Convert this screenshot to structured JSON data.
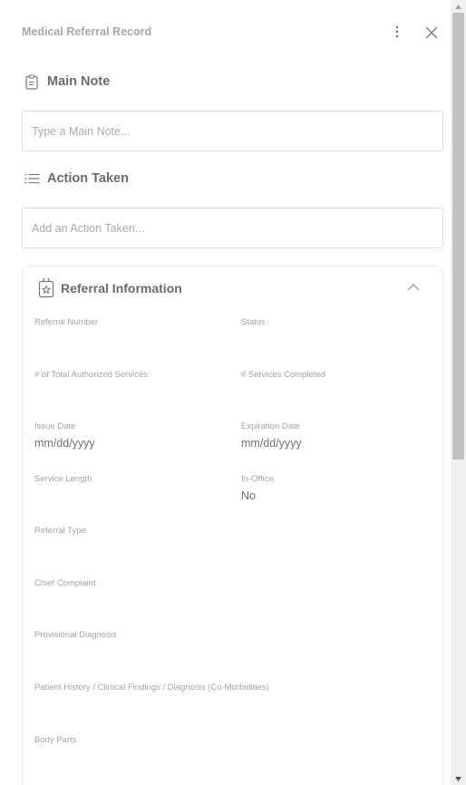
{
  "header": {
    "title": "Medical Referral Record",
    "more_icon": "kebab-vertical-icon",
    "close_icon": "close-icon"
  },
  "main_note": {
    "label": "Main Note",
    "icon": "clipboard-icon",
    "placeholder": "Type a Main Note..."
  },
  "action_taken": {
    "label": "Action Taken",
    "icon": "list-icon",
    "placeholder": "Add an Action Taken..."
  },
  "referral_info": {
    "label": "Referral Information",
    "icon": "referral-badge-icon",
    "collapse_icon": "chevron-up-icon",
    "fields": {
      "referral_number": {
        "label": "Referral Number",
        "value": ""
      },
      "status": {
        "label": "Status",
        "value": ""
      },
      "total_authorized": {
        "label": "# of Total Authorized Services",
        "value": ""
      },
      "services_completed": {
        "label": "# Services Completed",
        "value": ""
      },
      "issue_date": {
        "label": "Issue Date",
        "value": "mm/dd/yyyy"
      },
      "expiration_date": {
        "label": "Expiration Date",
        "value": "mm/dd/yyyy"
      },
      "service_length": {
        "label": "Service Length",
        "value": ""
      },
      "in_office": {
        "label": "In-Office",
        "value": "No"
      },
      "referral_type": {
        "label": "Referral Type",
        "value": ""
      },
      "chief_complaint": {
        "label": "Chief Complaint",
        "value": ""
      },
      "provisional_diagnosis": {
        "label": "Provisional Diagnosis",
        "value": ""
      },
      "patient_history": {
        "label": "Patient History / Clinical Findings / Diagnosis (Co-Morbidities)",
        "value": ""
      },
      "body_parts": {
        "label": "Body Parts",
        "value": ""
      }
    }
  },
  "colors": {
    "title": "#a8a8a8",
    "section_label": "#6b6b6b",
    "field_label": "#a3a3a3",
    "border": "#dcdcdc",
    "scrollbar_thumb": "#c1c1c1"
  }
}
